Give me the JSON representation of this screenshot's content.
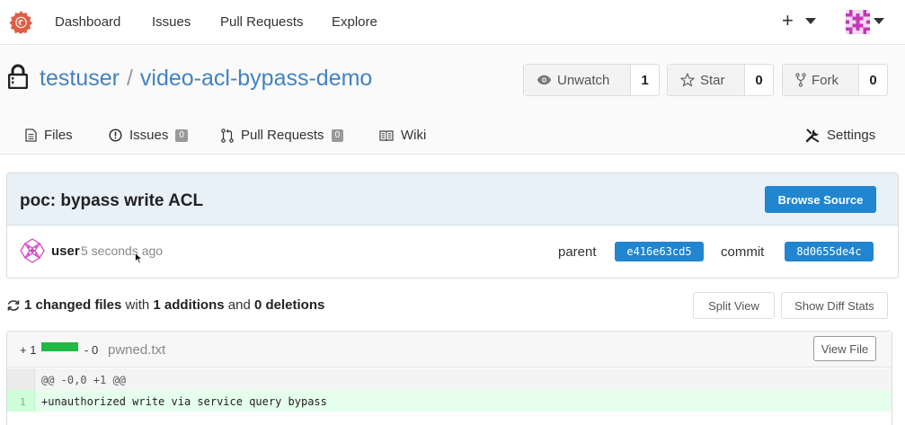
{
  "nav": {
    "items": [
      "Dashboard",
      "Issues",
      "Pull Requests",
      "Explore"
    ],
    "create_symbol": "+"
  },
  "repo": {
    "owner": "testuser",
    "separator": "/",
    "name": "video-acl-bypass-demo",
    "watch": {
      "label": "Unwatch",
      "count": "1"
    },
    "star": {
      "label": "Star",
      "count": "0"
    },
    "fork": {
      "label": "Fork",
      "count": "0"
    }
  },
  "tabs": {
    "files": "Files",
    "issues": {
      "label": "Issues",
      "count": "0"
    },
    "pulls": {
      "label": "Pull Requests",
      "count": "0"
    },
    "wiki": "Wiki",
    "settings": "Settings"
  },
  "commit": {
    "title": "poc: bypass write ACL",
    "browse_label": "Browse Source",
    "author": "user",
    "time": "5 seconds ago",
    "parent_label": "parent",
    "parent_sha": "e416e63cd5",
    "commit_label": "commit",
    "commit_sha": "8d0655de4c"
  },
  "stats": {
    "changed": "1 changed files",
    "with": "with",
    "additions": "1 additions",
    "and": "and",
    "deletions": "0 deletions",
    "split_view": "Split View",
    "show_diff_stats": "Show Diff Stats"
  },
  "file": {
    "additions": "+ 1",
    "deletions": "- 0",
    "name": "pwned.txt",
    "view_file": "View File",
    "hunk": "@@ -0,0 +1 @@",
    "lines": [
      {
        "no": "1",
        "text": "+unauthorized write via service query bypass"
      }
    ]
  },
  "colors": {
    "link": "#4183c4",
    "primary": "#2185d0",
    "logo": "#e05d44",
    "addition": "#21ba45"
  }
}
